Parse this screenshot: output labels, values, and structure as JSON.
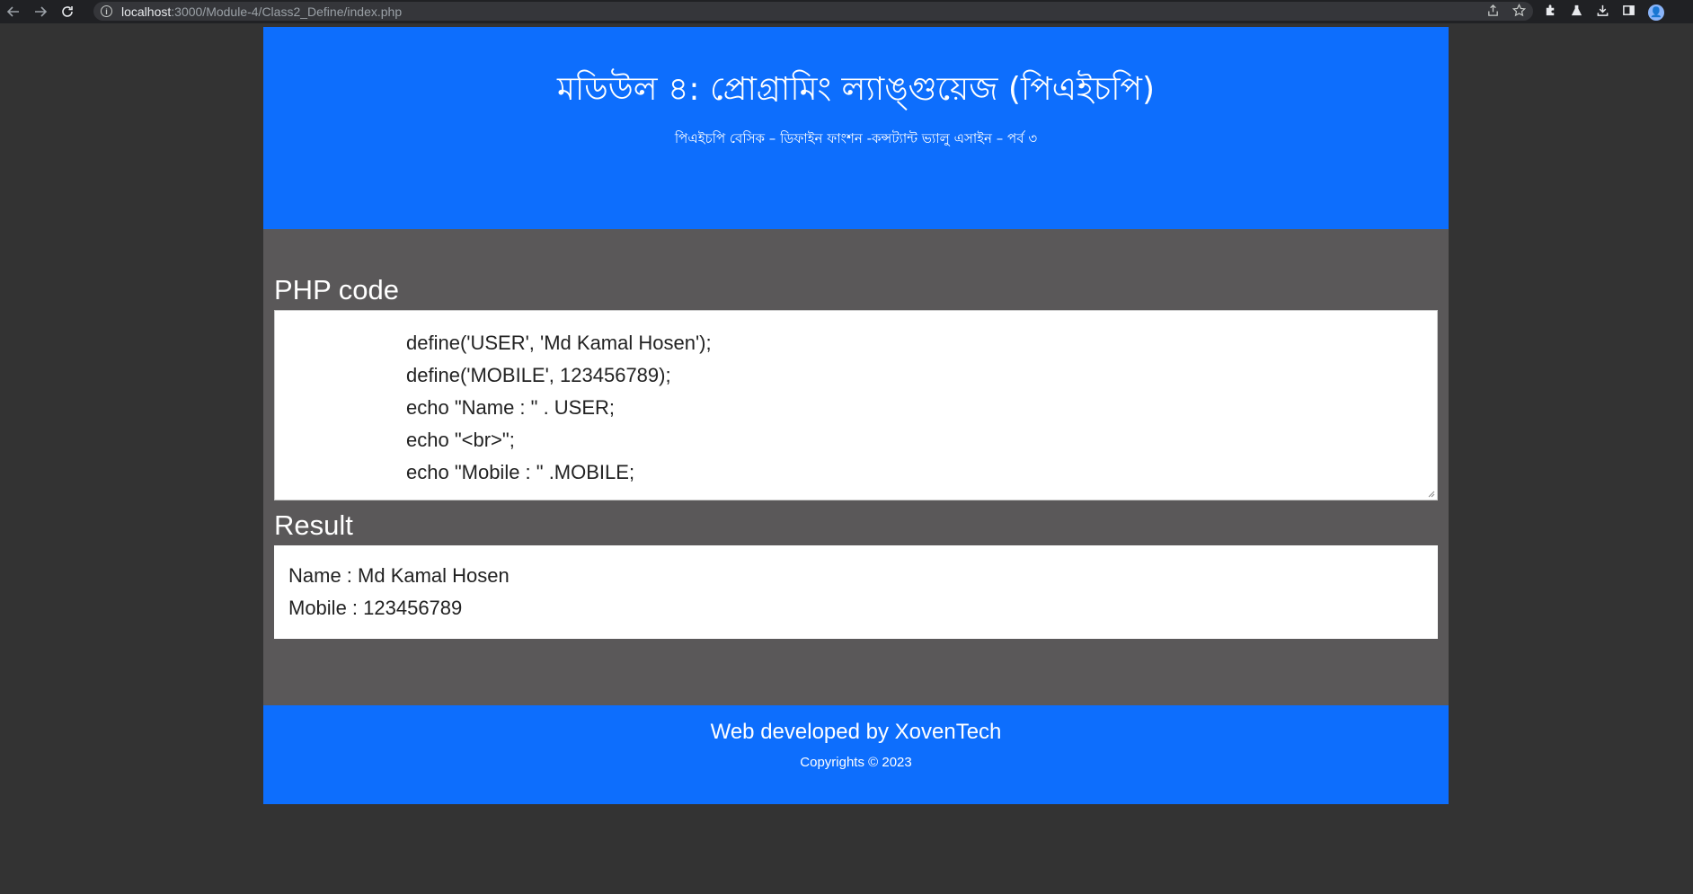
{
  "browser": {
    "url_host": "localhost",
    "url_path": ":3000/Module-4/Class2_Define/index.php",
    "avatar_initial": "👤"
  },
  "header": {
    "title": "মডিউল ৪: প্রোগ্রামিং ল্যাঙ্গুয়েজ (পিএইচপি)",
    "subtitle": "পিএইচপি বেসিক – ডিফাইন ফাংশন -কন্সট্যান্ট ভ্যালু এসাইন – পর্ব ৩"
  },
  "main": {
    "code_title": "PHP code",
    "code_lines": [
      "define('USER', 'Md Kamal Hosen');",
      "define('MOBILE', 123456789);",
      "echo \"Name : \" . USER;",
      "echo \"<br>\";",
      "echo \"Mobile : \" .MOBILE;"
    ],
    "result_title": "Result",
    "result_lines": [
      "Name : Md Kamal Hosen",
      "Mobile : 123456789"
    ]
  },
  "footer": {
    "credit": "Web developed by XovenTech",
    "copyright": "Copyrights © 2023"
  },
  "colors": {
    "header_bg": "#0d6efd",
    "main_bg": "#5a5859",
    "page_bg": "#333333"
  }
}
